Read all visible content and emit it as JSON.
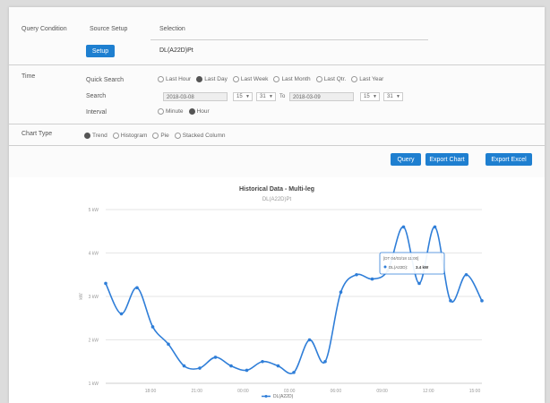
{
  "form": {
    "query_condition_label": "Query Condition",
    "source_setup_label": "Source Setup",
    "selection_label": "Selection",
    "setup_button": "Setup",
    "selection_value": "DL(A22D)Pt",
    "time_label": "Time",
    "quick_search_label": "Quick Search",
    "quick_options": [
      "Last Hour",
      "Last Day",
      "Last Week",
      "Last Month",
      "Last Qtr.",
      "Last Year"
    ],
    "quick_selected": 1,
    "search_label": "Search",
    "date_from": "2018-03-08",
    "hour_from": "15",
    "min_from": "31",
    "to_label": "To",
    "date_to": "2018-03-09",
    "hour_to": "15",
    "min_to": "31",
    "interval_label": "Interval",
    "interval_options": [
      "Minute",
      "Hour"
    ],
    "interval_selected": 1,
    "chart_type_label": "Chart Type",
    "chart_type_options": [
      "Trend",
      "Histogram",
      "Pie",
      "Stacked Column"
    ],
    "chart_type_selected": 0,
    "query_button": "Query",
    "export_chart_button": "Export Chart",
    "export_excel_button": "Export Excel"
  },
  "chart_data": {
    "type": "line",
    "title": "Historical Data - Multi-leg",
    "subtitle": "DL(A22D)Pt",
    "ylabel": "kW",
    "ylim": [
      1,
      5
    ],
    "yticks": [
      1,
      2,
      3,
      4,
      5
    ],
    "ytick_labels": [
      "1 kW",
      "2 kW",
      "3 kW",
      "4 kW",
      "5 kW"
    ],
    "xtick_labels": [
      "18:00",
      "21:00",
      "00:00",
      "03:00",
      "06:00",
      "09:00",
      "12:00",
      "15:00"
    ],
    "x": [
      0,
      1,
      2,
      3,
      4,
      5,
      6,
      7,
      8,
      9,
      10,
      11,
      12,
      13,
      14,
      15,
      16,
      17,
      18,
      19,
      20,
      21,
      22,
      23,
      24
    ],
    "series": [
      {
        "name": "DL(A22D)",
        "color": "#2f7ed8",
        "values": [
          3.3,
          2.6,
          3.2,
          2.3,
          1.9,
          1.4,
          1.35,
          1.6,
          1.4,
          1.3,
          1.5,
          1.4,
          1.25,
          2.0,
          1.5,
          3.1,
          3.5,
          3.4,
          3.6,
          4.6,
          3.3,
          4.6,
          2.9,
          3.5,
          2.9
        ]
      }
    ],
    "tooltip": {
      "time": "[DT 04/03/18 11:00]",
      "series": "DL(A22D)",
      "value": "3.4 kW"
    },
    "grid": true,
    "legend": "bottom-center"
  }
}
